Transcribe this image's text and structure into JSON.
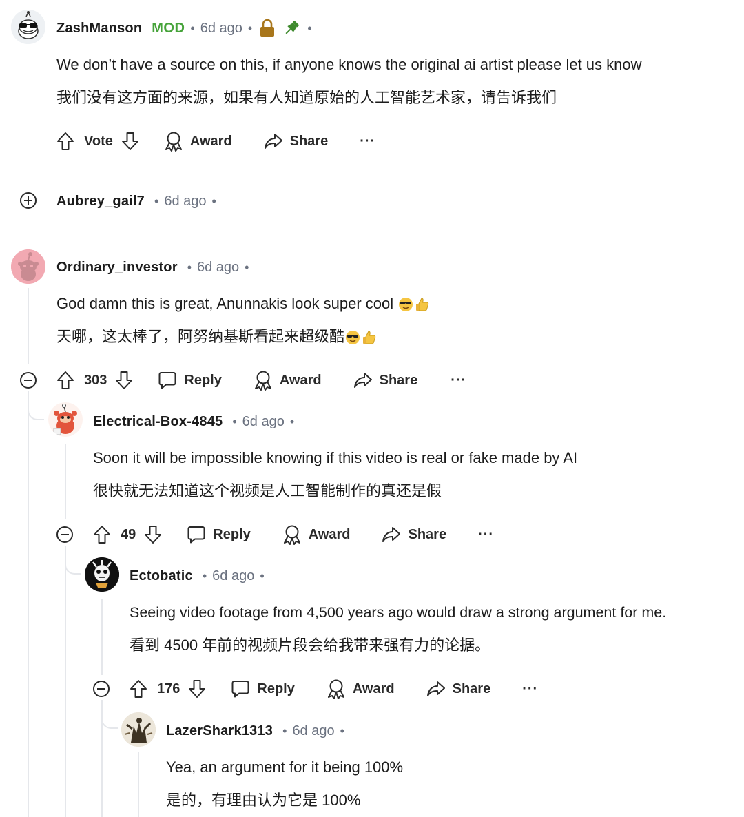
{
  "comments": [
    {
      "username": "ZashManson",
      "badge": "MOD",
      "time": "6d ago",
      "text_en": "We don’t have a source on this, if anyone knows the original ai artist please let us know",
      "text_zh": "我们没有这方面的来源，如果有人知道原始的人工智能艺术家，请告诉我们",
      "vote_label": "Vote",
      "award_label": "Award",
      "share_label": "Share"
    },
    {
      "username": "Aubrey_gail7",
      "time": "6d ago"
    },
    {
      "username": "Ordinary_investor",
      "time": "6d ago",
      "text_en": "God damn this is great, Anunnakis look super cool",
      "text_zh": "天哪，这太棒了，阿努纳基斯看起来超级酷",
      "votes": "303",
      "reply_label": "Reply",
      "award_label": "Award",
      "share_label": "Share"
    },
    {
      "username": "Electrical-Box-4845",
      "time": "6d ago",
      "text_en": "Soon it will be impossible knowing if this video is real or fake made by AI",
      "text_zh": "很快就无法知道这个视频是人工智能制作的真还是假",
      "votes": "49",
      "reply_label": "Reply",
      "award_label": "Award",
      "share_label": "Share"
    },
    {
      "username": "Ectobatic",
      "time": "6d ago",
      "text_en": "Seeing video footage from 4,500 years ago would draw a strong argument for me.",
      "text_zh": "看到 4500 年前的视频片段会给我带来强有力的论据。",
      "votes": "176",
      "reply_label": "Reply",
      "award_label": "Award",
      "share_label": "Share"
    },
    {
      "username": "LazerShark1313",
      "time": "6d ago",
      "text_en": "Yea, an argument for it being 100%",
      "text_zh": "是的，有理由认为它是 100%"
    }
  ],
  "separator": "•",
  "more_label": "···",
  "icons": {
    "upvote": "arrow-up-outline",
    "downvote": "arrow-down-outline",
    "reply": "speech-bubble",
    "award": "award-ribbon",
    "share": "share-arrow",
    "lock": "lock",
    "pin": "pin",
    "collapse": "circle-minus",
    "expand": "circle-plus",
    "emoji_cool": "smiling-face-with-sunglasses",
    "emoji_thumb": "thumbs-up"
  },
  "colors": {
    "mod_badge": "#46a33a",
    "meta_gray": "#6b7280",
    "lock_gold": "#a8761b",
    "pin_green": "#3f8a2e",
    "thread_line": "#e5e7eb"
  }
}
